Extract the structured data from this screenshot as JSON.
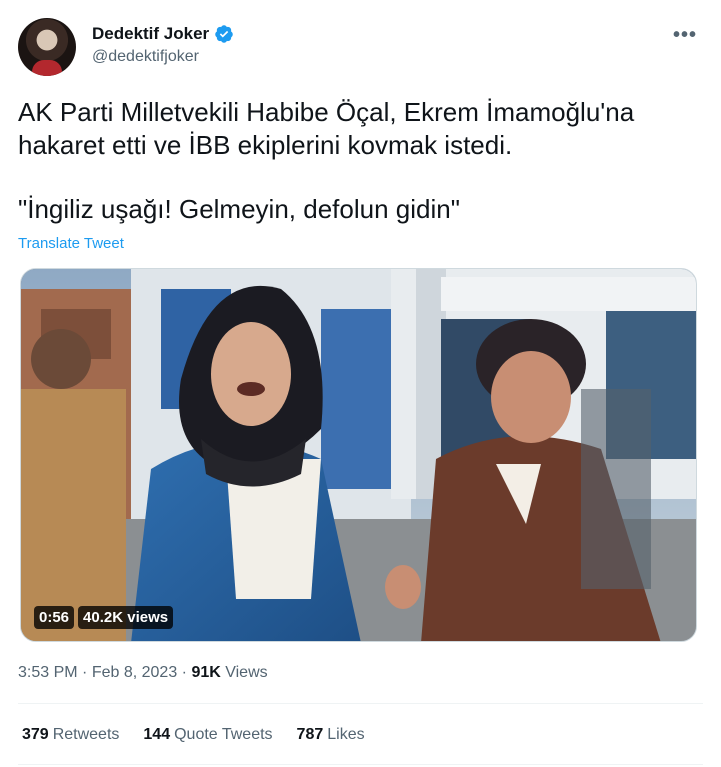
{
  "author": {
    "display_name": "Dedektif Joker",
    "handle": "@dedektifjoker",
    "verified_icon": "verified-badge-icon",
    "more_icon": "more-icon"
  },
  "tweet": {
    "line1": "AK Parti Milletvekili Habibe Öçal, Ekrem İmamoğlu'na hakaret etti ve İBB ekiplerini kovmak istedi.",
    "line2": "\"İngiliz uşağı! Gelmeyin, defolun gidin\"",
    "translate": "Translate Tweet"
  },
  "video": {
    "duration": "0:56",
    "views": "40.2K views"
  },
  "meta": {
    "time": "3:53 PM",
    "sep1": " · ",
    "date": "Feb 8, 2023",
    "sep2": " · ",
    "views_count": "91K",
    "views_label": " Views"
  },
  "stats": {
    "retweets_count": "379",
    "retweets_label": "Retweets",
    "quotes_count": "144",
    "quotes_label": "Quote Tweets",
    "likes_count": "787",
    "likes_label": "Likes"
  },
  "colors": {
    "accent": "#1d9bf0",
    "secondary_text": "#536471",
    "primary_text": "#0f1419"
  }
}
